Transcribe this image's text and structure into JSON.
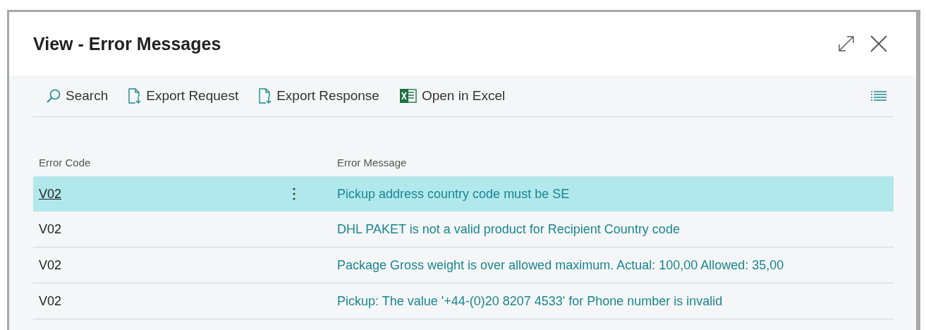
{
  "dialog": {
    "title": "View - Error Messages"
  },
  "toolbar": [
    {
      "kind": "search",
      "label": "Search"
    },
    {
      "kind": "export",
      "label": "Export Request"
    },
    {
      "kind": "export",
      "label": "Export Response"
    },
    {
      "kind": "excel",
      "label": "Open in Excel"
    }
  ],
  "table": {
    "columns": [
      "Error Code",
      "Error Message"
    ],
    "rows": [
      {
        "error_code": "V02",
        "error_message": "Pickup address country code must be SE",
        "selected": true
      },
      {
        "error_code": "V02",
        "error_message": "DHL PAKET is not a valid product for Recipient Country code",
        "selected": false
      },
      {
        "error_code": "V02",
        "error_message": "Package Gross weight is over allowed maximum. Actual: 100,00 Allowed: 35,00",
        "selected": false
      },
      {
        "error_code": "V02",
        "error_message": "Pickup: The value '+44-(0)20 8207 4533' for Phone number is invalid",
        "selected": false
      }
    ]
  }
}
